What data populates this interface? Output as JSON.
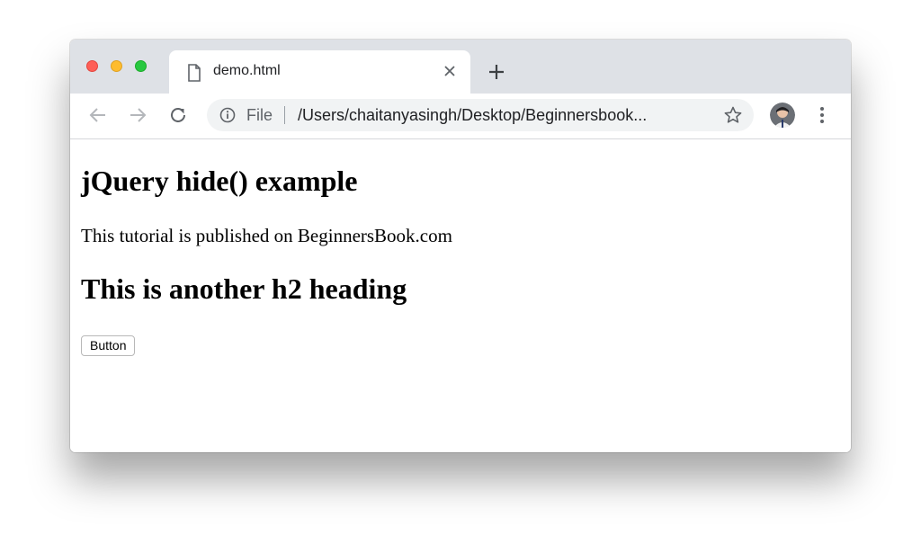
{
  "browser": {
    "tab": {
      "title": "demo.html",
      "icon": "document-icon",
      "close_icon": "close-icon"
    },
    "new_tab_icon": "plus-icon",
    "toolbar": {
      "back_icon": "arrow-left-icon",
      "forward_icon": "arrow-right-icon",
      "reload_icon": "reload-icon",
      "menu_icon": "kebab-menu-icon"
    },
    "omnibox": {
      "info_icon": "info-icon",
      "scheme_label": "File",
      "url": "/Users/chaitanyasingh/Desktop/Beginnersbook...",
      "bookmark_icon": "star-icon"
    },
    "colors": {
      "tabbar": "#dee1e6",
      "traffic_red": "#fe5f57",
      "traffic_yellow": "#febc2e",
      "traffic_green": "#28c840"
    }
  },
  "page": {
    "heading1": "jQuery hide() example",
    "paragraph": "This tutorial is published on BeginnersBook.com",
    "heading2": "This is another h2 heading",
    "button_label": "Button"
  }
}
